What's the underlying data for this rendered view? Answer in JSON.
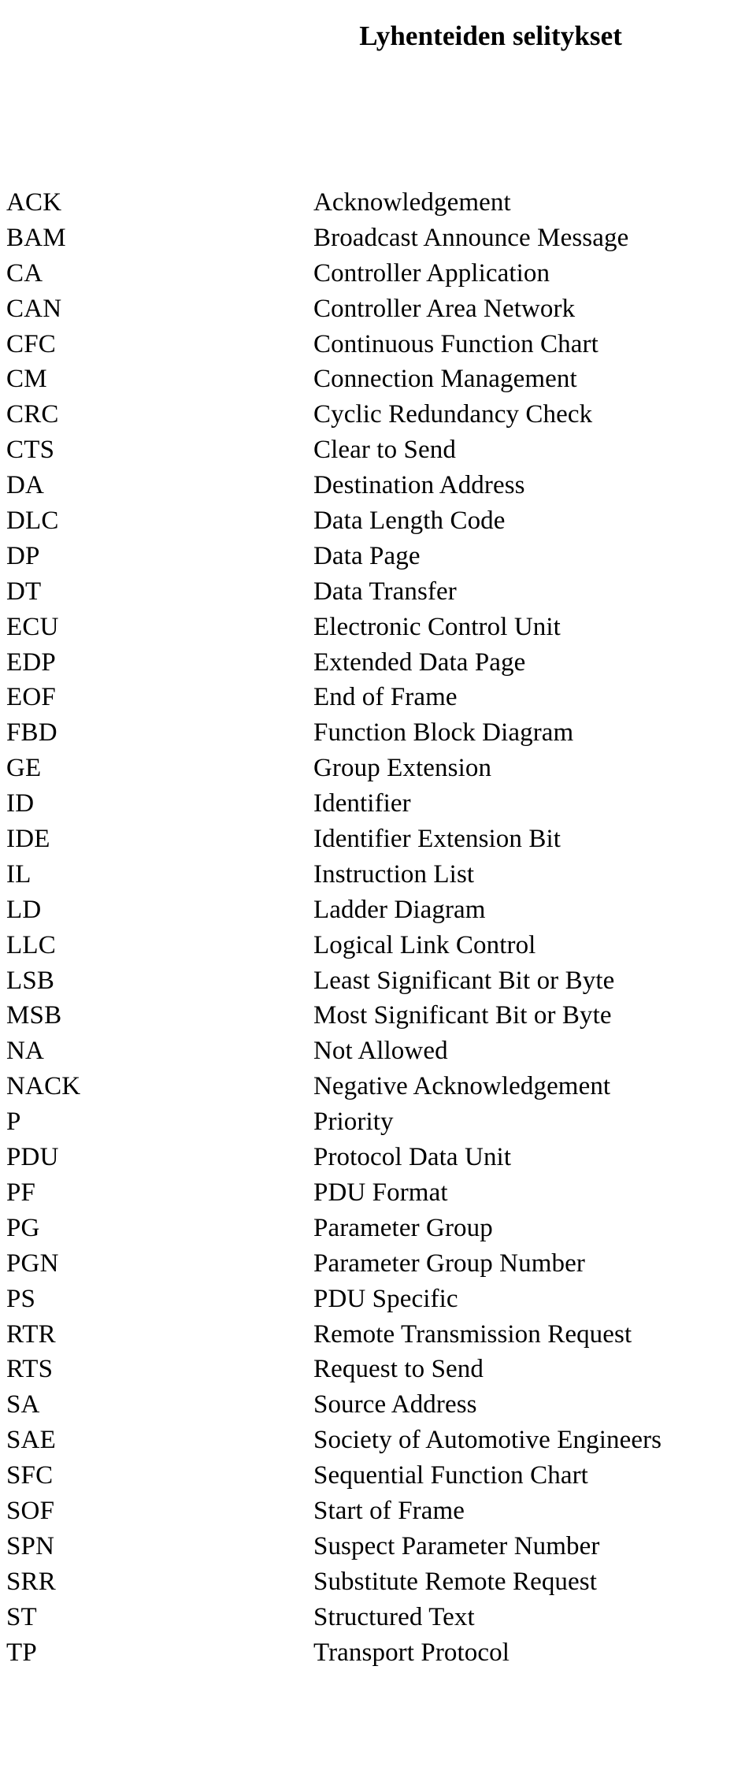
{
  "document": {
    "title": "Lyhenteiden selitykset",
    "columns": {
      "term_header": "",
      "definition_header": ""
    },
    "entries": [
      {
        "term": "ACK",
        "definition": "Acknowledgement"
      },
      {
        "term": "BAM",
        "definition": "Broadcast Announce Message"
      },
      {
        "term": "CA",
        "definition": "Controller Application"
      },
      {
        "term": "CAN",
        "definition": "Controller Area Network"
      },
      {
        "term": "CFC",
        "definition": "Continuous Function Chart"
      },
      {
        "term": "CM",
        "definition": "Connection Management"
      },
      {
        "term": "CRC",
        "definition": "Cyclic Redundancy Check"
      },
      {
        "term": "CTS",
        "definition": "Clear to Send"
      },
      {
        "term": "DA",
        "definition": "Destination Address"
      },
      {
        "term": "DLC",
        "definition": "Data Length Code"
      },
      {
        "term": "DP",
        "definition": "Data Page"
      },
      {
        "term": "DT",
        "definition": "Data Transfer"
      },
      {
        "term": "ECU",
        "definition": "Electronic Control Unit"
      },
      {
        "term": "EDP",
        "definition": "Extended Data Page"
      },
      {
        "term": "EOF",
        "definition": "End of Frame"
      },
      {
        "term": "FBD",
        "definition": "Function Block Diagram"
      },
      {
        "term": "GE",
        "definition": "Group Extension"
      },
      {
        "term": "ID",
        "definition": "Identifier"
      },
      {
        "term": "IDE",
        "definition": "Identifier Extension Bit"
      },
      {
        "term": "IL",
        "definition": "Instruction List"
      },
      {
        "term": "LD",
        "definition": "Ladder Diagram"
      },
      {
        "term": "LLC",
        "definition": "Logical Link Control"
      },
      {
        "term": "LSB",
        "definition": "Least Significant Bit or Byte"
      },
      {
        "term": "MSB",
        "definition": "Most Significant Bit or Byte"
      },
      {
        "term": "NA",
        "definition": "Not Allowed"
      },
      {
        "term": "NACK",
        "definition": "Negative Acknowledgement"
      },
      {
        "term": "P",
        "definition": "Priority"
      },
      {
        "term": "PDU",
        "definition": "Protocol Data Unit"
      },
      {
        "term": "PF",
        "definition": "PDU Format"
      },
      {
        "term": "PG",
        "definition": "Parameter Group"
      },
      {
        "term": "PGN",
        "definition": "Parameter Group Number"
      },
      {
        "term": "PS",
        "definition": "PDU Specific"
      },
      {
        "term": "RTR",
        "definition": "Remote Transmission Request"
      },
      {
        "term": "RTS",
        "definition": "Request to Send"
      },
      {
        "term": "SA",
        "definition": "Source Address"
      },
      {
        "term": "SAE",
        "definition": "Society of Automotive Engineers"
      },
      {
        "term": "SFC",
        "definition": "Sequential Function Chart"
      },
      {
        "term": "SOF",
        "definition": "Start of Frame"
      },
      {
        "term": "SPN",
        "definition": "Suspect Parameter Number"
      },
      {
        "term": "SRR",
        "definition": "Substitute Remote Request"
      },
      {
        "term": "ST",
        "definition": "Structured Text"
      },
      {
        "term": "TP",
        "definition": "Transport Protocol"
      }
    ]
  },
  "colors": {
    "page_background": "#ffffff",
    "text": "#000000"
  }
}
